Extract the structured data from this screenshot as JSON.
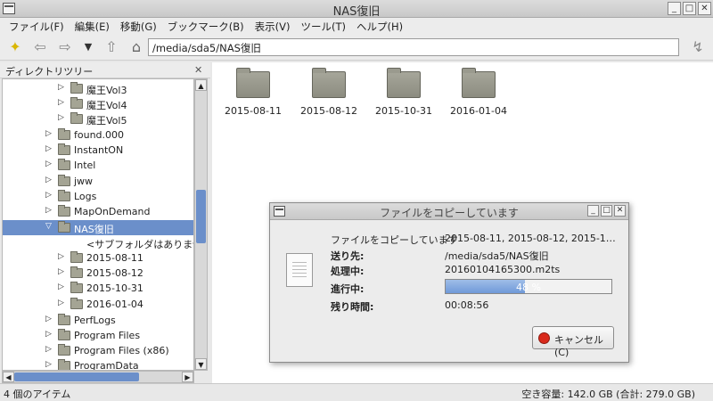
{
  "window": {
    "title": "NAS復旧",
    "btn_min": "_",
    "btn_max": "□",
    "btn_close": "✕"
  },
  "menu": [
    "ファイル(F)",
    "編集(E)",
    "移動(G)",
    "ブックマーク(B)",
    "表示(V)",
    "ツール(T)",
    "ヘルプ(H)"
  ],
  "toolbar": {
    "path": "/media/sda5/NAS復旧"
  },
  "sidebar": {
    "title": "ディレクトリツリー",
    "close": "✕",
    "items": [
      {
        "label": "魔王Vol3",
        "expander": "▷"
      },
      {
        "label": "魔王Vol4",
        "expander": "▷"
      },
      {
        "label": "魔王Vol5",
        "expander": "▷"
      },
      {
        "label": "found.000",
        "expander": "▷"
      },
      {
        "label": "InstantON",
        "expander": "▷"
      },
      {
        "label": "Intel",
        "expander": "▷"
      },
      {
        "label": "jww",
        "expander": "▷"
      },
      {
        "label": "Logs",
        "expander": "▷"
      },
      {
        "label": "MapOnDemand",
        "expander": "▷"
      },
      {
        "label": "NAS復旧",
        "expander": "▽"
      },
      {
        "label": "<サブフォルダはありません>",
        "expander": ""
      },
      {
        "label": "2015-08-11",
        "expander": "▷"
      },
      {
        "label": "2015-08-12",
        "expander": "▷"
      },
      {
        "label": "2015-10-31",
        "expander": "▷"
      },
      {
        "label": "2016-01-04",
        "expander": "▷"
      },
      {
        "label": "PerfLogs",
        "expander": "▷"
      },
      {
        "label": "Program Files",
        "expander": "▷"
      },
      {
        "label": "Program Files (x86)",
        "expander": "▷"
      },
      {
        "label": "ProgramData",
        "expander": "▷"
      }
    ]
  },
  "main": {
    "folders": [
      "2015-08-11",
      "2015-08-12",
      "2015-10-31",
      "2016-01-04"
    ]
  },
  "status": {
    "items": "4 個のアイテム",
    "free_space": "空き容量: 142.0 GB (合計: 279.0 GB)"
  },
  "dialog": {
    "title": "ファイルをコピーしています",
    "rows": [
      {
        "label": "ファイルをコピーしています",
        "value": "2015-08-11, 2015-08-12, 2015-1…",
        "bold": false
      },
      {
        "label": "送り先:",
        "value": "/media/sda5/NAS復旧",
        "bold": true
      },
      {
        "label": "処理中:",
        "value": "20160104165300.m2ts",
        "bold": true
      },
      {
        "label": "進行中:",
        "value": "",
        "bold": true
      },
      {
        "label": "残り時間:",
        "value": "00:08:56",
        "bold": true
      }
    ],
    "progress_percent": 48,
    "progress_text": "48 %",
    "cancel_label": "キャンセル(C)"
  },
  "colors": {
    "selection": "#6b8fca",
    "progress": "#7ba2dc",
    "cancel_icon": "#d92a1c"
  }
}
